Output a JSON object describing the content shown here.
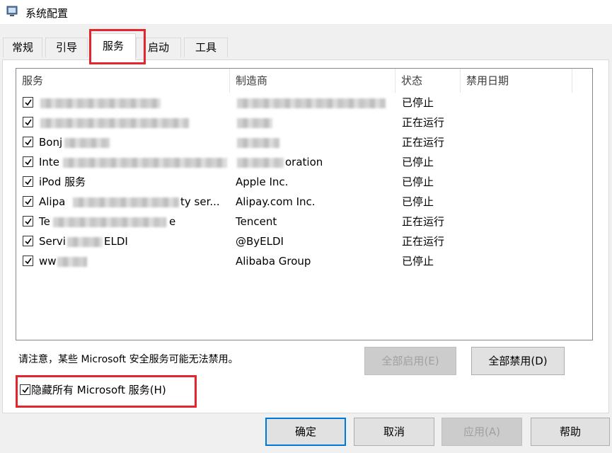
{
  "window": {
    "title": "系统配置"
  },
  "tabs": [
    {
      "label": "常规"
    },
    {
      "label": "引导"
    },
    {
      "label": "服务"
    },
    {
      "label": "启动"
    },
    {
      "label": "工具"
    }
  ],
  "active_tab": "服务",
  "services_table": {
    "columns": [
      "服务",
      "制造商",
      "状态",
      "禁用日期"
    ],
    "rows": [
      {
        "checked": true,
        "name": "",
        "manufacturer": "",
        "status": "已停止",
        "disabled_date": ""
      },
      {
        "checked": true,
        "name": "",
        "manufacturer": "",
        "status": "正在运行",
        "disabled_date": ""
      },
      {
        "checked": true,
        "name": "Bonj",
        "manufacturer": "",
        "status": "正在运行",
        "disabled_date": ""
      },
      {
        "checked": true,
        "name": "Inte",
        "manufacturer": "oration",
        "status": "已停止",
        "disabled_date": ""
      },
      {
        "checked": true,
        "name": "iPod 服务",
        "manufacturer": "Apple Inc.",
        "status": "已停止",
        "disabled_date": ""
      },
      {
        "checked": true,
        "name": "Alipa",
        "name_tail": "ty ser...",
        "manufacturer": "Alipay.com Inc.",
        "status": "已停止",
        "disabled_date": ""
      },
      {
        "checked": true,
        "name": "Te",
        "name_tail": "e",
        "manufacturer": "Tencent",
        "status": "正在运行",
        "disabled_date": ""
      },
      {
        "checked": true,
        "name": "Servi",
        "name_tail": "ELDI",
        "manufacturer": "@ByELDI",
        "status": "正在运行",
        "disabled_date": ""
      },
      {
        "checked": true,
        "name": "ww",
        "manufacturer": "Alibaba Group",
        "status": "已停止",
        "disabled_date": ""
      }
    ]
  },
  "note": "请注意，某些 Microsoft 安全服务可能无法禁用。",
  "buttons": {
    "enable_all": "全部启用(E)",
    "disable_all": "全部禁用(D)",
    "ok": "确定",
    "cancel": "取消",
    "apply": "应用(A)",
    "help": "帮助"
  },
  "hide_microsoft": {
    "checked": true,
    "label": "隐藏所有 Microsoft 服务(H)"
  },
  "colors": {
    "highlight": "#e3252d",
    "default_button_border": "#0078d7"
  }
}
